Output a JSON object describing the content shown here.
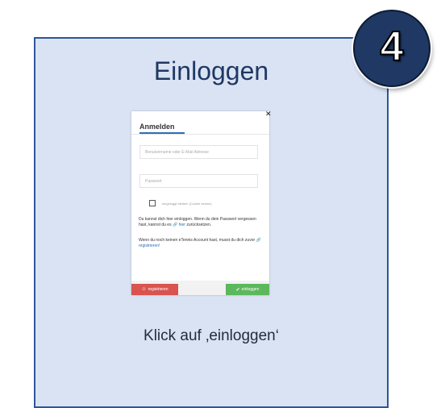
{
  "card": {
    "title": "Einloggen",
    "caption": "Klick auf ‚einloggen‘"
  },
  "step": {
    "number": "4"
  },
  "dialog": {
    "title": "Anmelden",
    "close": "✕",
    "username_placeholder": "Benutzername oder E-Mail Adresse",
    "password_placeholder": "Passwort",
    "remember_label": "eingeloggt bleiben (Cookie setzen)",
    "forgot_text_1": "Du kannst dich hier einloggen. Wenn du dein Passwort vergessen hast, kannst du es",
    "forgot_link": "hier",
    "forgot_text_2": "zurücksetzen.",
    "register_text_1": "Wenn du noch keinen eTennis Account hast, musst du dich zuvor",
    "register_link": "registrieren!",
    "register_button": "registrieren",
    "login_button": "einloggen"
  },
  "icons": {
    "link": "link-icon",
    "register": "user-icon",
    "login": "check-icon"
  },
  "colors": {
    "card_bg": "#dae3f3",
    "card_border": "#2f5597",
    "badge_bg": "#1f3864",
    "register_btn": "#d9534f",
    "login_btn": "#5cb85c",
    "link": "#2f6db5"
  }
}
